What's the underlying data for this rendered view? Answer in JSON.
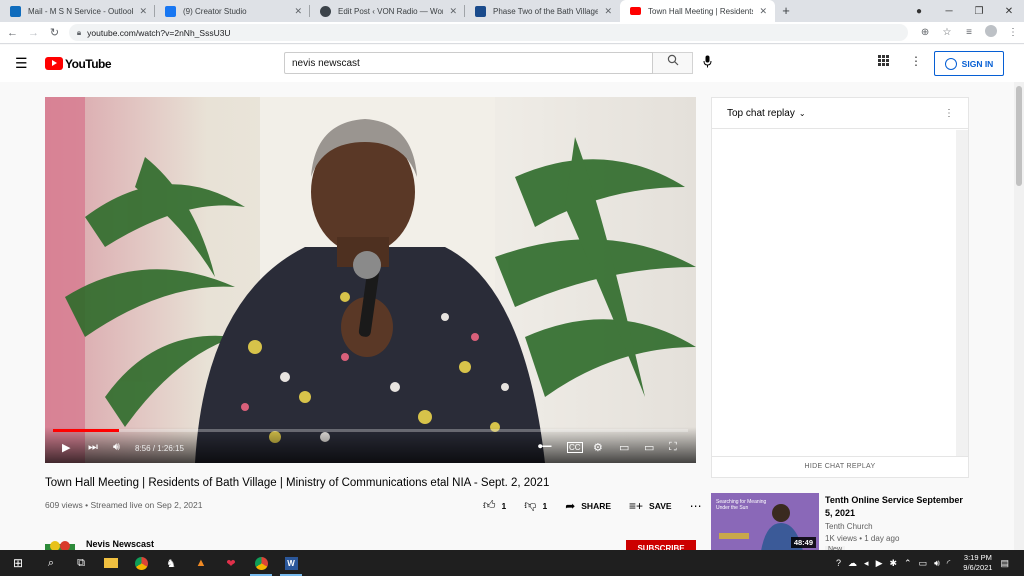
{
  "browser": {
    "tabs": [
      {
        "label": "Mail - M S N Service - Outlook",
        "color": "#0f6cbd"
      },
      {
        "label": "(9) Creator Studio",
        "color": "#1877f2"
      },
      {
        "label": "Edit Post ‹ VON Radio — WordPr",
        "color": "#3c434a"
      },
      {
        "label": "Phase Two of the Bath Village Ro",
        "color": "#1a4b8c"
      },
      {
        "label": "Town Hall Meeting | Residents of",
        "color": "#ff0000"
      }
    ],
    "new_tab": "+",
    "url": "youtube.com/watch?v=2nNh_SssU3U"
  },
  "youtube": {
    "logo_text": "YouTube",
    "search_value": "nevis newscast",
    "sign_in": "SIGN IN"
  },
  "player": {
    "time": "8:56 / 1:26:15",
    "progress_fraction": 0.104
  },
  "video": {
    "title": "Town Hall Meeting | Residents of Bath Village | Ministry of Communications etal NIA - Sept. 2, 2021",
    "meta": "609 views • Streamed live on Sep 2, 2021",
    "likes": "1",
    "dislikes": "1",
    "share": "SHARE",
    "save": "SAVE",
    "channel": "Nevis Newscast",
    "subscribe": "SUBSCRIBE"
  },
  "chat": {
    "header": "Top chat replay",
    "hide_label": "HIDE CHAT REPLAY"
  },
  "recommendation": {
    "thumb_text": "Searching for Meaning Under the Sun",
    "duration": "48:49",
    "title": "Tenth Online Service September 5, 2021",
    "channel": "Tenth Church",
    "views": "1K views • 1 day ago",
    "badge": "New"
  },
  "taskbar": {
    "time": "3:19 PM",
    "date": "9/6/2021"
  }
}
